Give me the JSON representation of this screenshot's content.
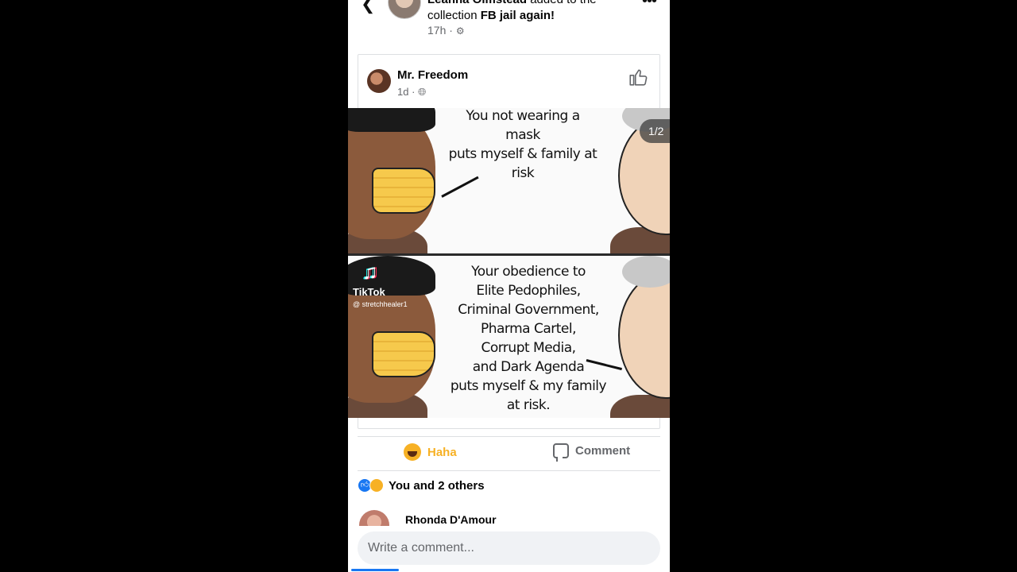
{
  "header": {
    "author": "Leanna Olmstead",
    "action": " added to the collection ",
    "collection": "FB jail again!",
    "time": "17h",
    "back_icon": "chevron-left-icon",
    "more_icon": "more-dots-icon"
  },
  "shared_post": {
    "author": "Mr. Freedom",
    "time": "1d",
    "audience_icon": "globe-icon",
    "like_icon": "thumbs-up-icon"
  },
  "meme": {
    "counter": "1/2",
    "panel1_lines": [
      "You not wearing a",
      "mask",
      "puts myself & family at",
      "risk"
    ],
    "panel2_lines": [
      "Your obedience to",
      "Elite Pedophiles,",
      "Criminal Government,",
      "Pharma Cartel,",
      "Corrupt Media,",
      "and Dark Agenda",
      "puts myself & my family",
      "at risk."
    ],
    "watermark_name": "TikTok",
    "watermark_user": "@ stretchhealer1"
  },
  "actions": {
    "haha_label": "Haha",
    "comment_label": "Comment"
  },
  "reactions": {
    "summary": "You and 2 others"
  },
  "comments": [
    {
      "name": "Rhonda D'Amour"
    }
  ],
  "composer": {
    "placeholder": "Write a comment..."
  },
  "colors": {
    "haha": "#f7b125",
    "like_blue": "#1877f2",
    "secondary_text": "#65676b"
  }
}
